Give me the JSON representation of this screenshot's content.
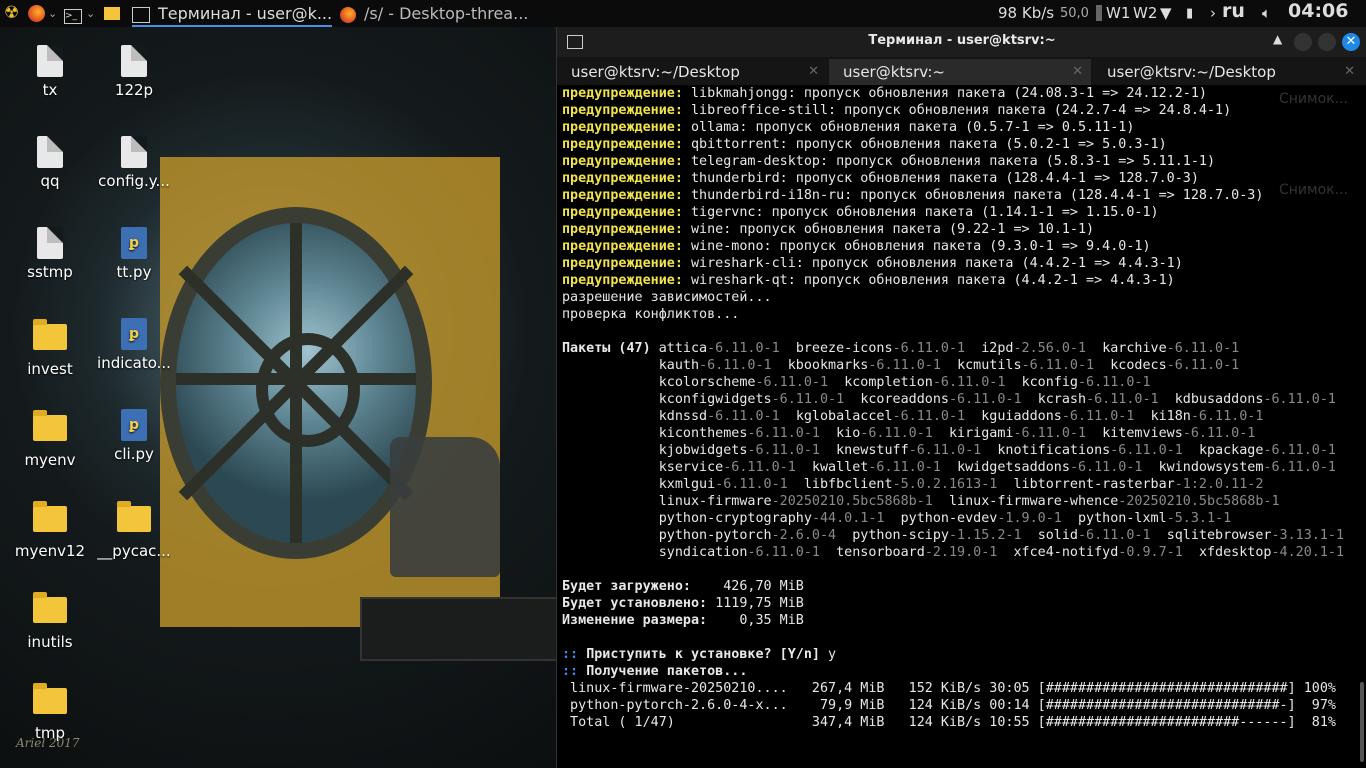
{
  "panel": {
    "firefox_tab": "Терминал - user@k...",
    "task2": "/s/ - Desktop-threa...",
    "net_speed": "98 Kb/s",
    "cpu": "50,0",
    "workspaces": [
      "W1",
      "W2"
    ],
    "lang": "ru",
    "clock": "04:06"
  },
  "desktop_icons": [
    "tx",
    "122p",
    "qq",
    "config.y...",
    "sstmp",
    "tt.py",
    "invest",
    "indicato...",
    "myenv",
    "cli.py",
    "myenv12",
    "__pycac...",
    "inutils",
    "tmp"
  ],
  "signature": "Ariel 2017",
  "window": {
    "title": "Терминал - user@ktsrv:~",
    "tabs": [
      "user@ktsrv:~/Desktop",
      "user@ktsrv:~",
      "user@ktsrv:~/Desktop"
    ],
    "ghost_text": [
      "Снимок...",
      "Снимок..."
    ]
  },
  "warn_label": "предупреждение:",
  "warnings": [
    "libkmahjongg: пропуск обновления пакета (24.08.3-1 => 24.12.2-1)",
    "libreoffice-still: пропуск обновления пакета (24.2.7-4 => 24.8.4-1)",
    "ollama: пропуск обновления пакета (0.5.7-1 => 0.5.11-1)",
    "qbittorrent: пропуск обновления пакета (5.0.2-1 => 5.0.3-1)",
    "telegram-desktop: пропуск обновления пакета (5.8.3-1 => 5.11.1-1)",
    "thunderbird: пропуск обновления пакета (128.4.4-1 => 128.7.0-3)",
    "thunderbird-i18n-ru: пропуск обновления пакета (128.4.4-1 => 128.7.0-3)",
    "tigervnc: пропуск обновления пакета (1.14.1-1 => 1.15.0-1)",
    "wine: пропуск обновления пакета (9.22-1 => 10.1-1)",
    "wine-mono: пропуск обновления пакета (9.3.0-1 => 9.4.0-1)",
    "wireshark-cli: пропуск обновления пакета (4.4.2-1 => 4.4.3-1)",
    "wireshark-qt: пропуск обновления пакета (4.4.2-1 => 4.4.3-1)"
  ],
  "status_lines": [
    "разрешение зависимостей...",
    "проверка конфликтов..."
  ],
  "packages_label": "Пакеты (47)",
  "package_rows": [
    [
      [
        "attica",
        "-6.11.0-1"
      ],
      [
        "breeze-icons",
        "-6.11.0-1"
      ],
      [
        "i2pd",
        "-2.56.0-1"
      ],
      [
        "karchive",
        "-6.11.0-1"
      ]
    ],
    [
      [
        "kauth",
        "-6.11.0-1"
      ],
      [
        "kbookmarks",
        "-6.11.0-1"
      ],
      [
        "kcmutils",
        "-6.11.0-1"
      ],
      [
        "kcodecs",
        "-6.11.0-1"
      ]
    ],
    [
      [
        "kcolorscheme",
        "-6.11.0-1"
      ],
      [
        "kcompletion",
        "-6.11.0-1"
      ],
      [
        "kconfig",
        "-6.11.0-1"
      ]
    ],
    [
      [
        "kconfigwidgets",
        "-6.11.0-1"
      ],
      [
        "kcoreaddons",
        "-6.11.0-1"
      ],
      [
        "kcrash",
        "-6.11.0-1"
      ],
      [
        "kdbusaddons",
        "-6.11.0-1"
      ]
    ],
    [
      [
        "kdnssd",
        "-6.11.0-1"
      ],
      [
        "kglobalaccel",
        "-6.11.0-1"
      ],
      [
        "kguiaddons",
        "-6.11.0-1"
      ],
      [
        "ki18n",
        "-6.11.0-1"
      ]
    ],
    [
      [
        "kiconthemes",
        "-6.11.0-1"
      ],
      [
        "kio",
        "-6.11.0-1"
      ],
      [
        "kirigami",
        "-6.11.0-1"
      ],
      [
        "kitemviews",
        "-6.11.0-1"
      ]
    ],
    [
      [
        "kjobwidgets",
        "-6.11.0-1"
      ],
      [
        "knewstuff",
        "-6.11.0-1"
      ],
      [
        "knotifications",
        "-6.11.0-1"
      ],
      [
        "kpackage",
        "-6.11.0-1"
      ]
    ],
    [
      [
        "kservice",
        "-6.11.0-1"
      ],
      [
        "kwallet",
        "-6.11.0-1"
      ],
      [
        "kwidgetsaddons",
        "-6.11.0-1"
      ],
      [
        "kwindowsystem",
        "-6.11.0-1"
      ]
    ],
    [
      [
        "kxmlgui",
        "-6.11.0-1"
      ],
      [
        "libfbclient",
        "-5.0.2.1613-1"
      ],
      [
        "libtorrent-rasterbar",
        "-1:2.0.11-2"
      ]
    ],
    [
      [
        "linux-firmware",
        "-20250210.5bc5868b-1"
      ],
      [
        "linux-firmware-whence",
        "-20250210.5bc5868b-1"
      ]
    ],
    [
      [
        "python-cryptography",
        "-44.0.1-1"
      ],
      [
        "python-evdev",
        "-1.9.0-1"
      ],
      [
        "python-lxml",
        "-5.3.1-1"
      ]
    ],
    [
      [
        "python-pytorch",
        "-2.6.0-4"
      ],
      [
        "python-scipy",
        "-1.15.2-1"
      ],
      [
        "solid",
        "-6.11.0-1"
      ],
      [
        "sqlitebrowser",
        "-3.13.1-1"
      ]
    ],
    [
      [
        "syndication",
        "-6.11.0-1"
      ],
      [
        "tensorboard",
        "-2.19.0-1"
      ],
      [
        "xfce4-notifyd",
        "-0.9.7-1"
      ],
      [
        "xfdesktop",
        "-4.20.1-1"
      ]
    ]
  ],
  "sizes": [
    [
      "Будет загружено:",
      "426,70 MiB"
    ],
    [
      "Будет установлено:",
      "1119,75 MiB"
    ],
    [
      "Изменение размера:",
      "0,35 MiB"
    ]
  ],
  "prompt_marker": "::",
  "prompt": "Приступить к установке? [Y/n]",
  "prompt_answer": "y",
  "getting": "Получение пакетов...",
  "downloads": [
    " linux-firmware-20250210....   267,4 MiB   152 KiB/s 30:05 [##############################] 100%",
    " python-pytorch-2.6.0-4-x...    79,9 MiB   124 KiB/s 00:14 [#############################-]  97%",
    " Total ( 1/47)                 347,4 MiB   124 KiB/s 10:55 [########################------]  81%"
  ]
}
